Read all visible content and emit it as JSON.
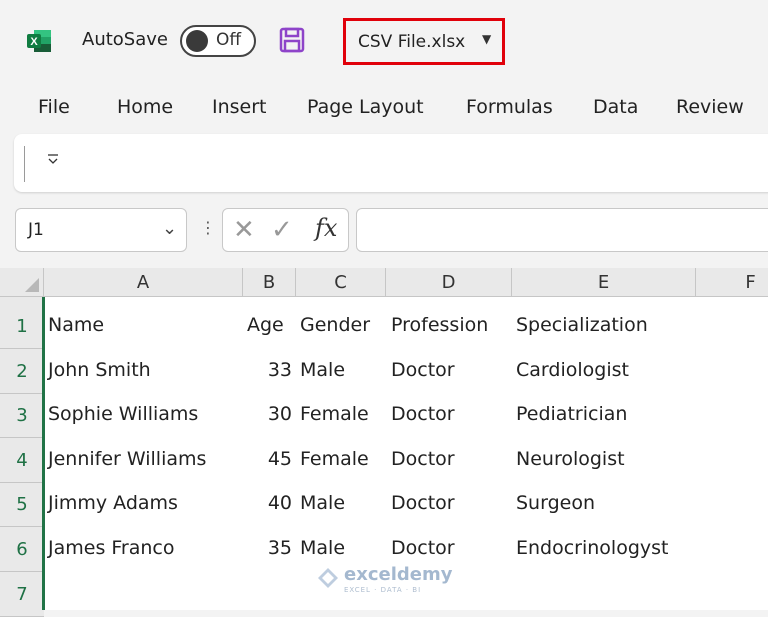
{
  "titlebar": {
    "autosave_label": "AutoSave",
    "autosave_state": "Off",
    "file_name": "CSV File.xlsx",
    "accent": "#e0000a",
    "excel_green": "#217346"
  },
  "menu": [
    "File",
    "Home",
    "Insert",
    "Page Layout",
    "Formulas",
    "Data",
    "Review"
  ],
  "formula_bar": {
    "name_box": "J1",
    "fx_label": "fx",
    "formula": ""
  },
  "sheet": {
    "columns": [
      "A",
      "B",
      "C",
      "D",
      "E",
      "F"
    ],
    "rows": [
      "1",
      "2",
      "3",
      "4",
      "5",
      "6",
      "7"
    ],
    "cells": [
      [
        "Name",
        "Age",
        "Gender",
        "Profession",
        "Specialization"
      ],
      [
        "John Smith",
        "33",
        "Male",
        "Doctor",
        "Cardiologist"
      ],
      [
        "Sophie Williams",
        "30",
        "Female",
        "Doctor",
        "Pediatrician"
      ],
      [
        "Jennifer Williams",
        "45",
        "Female",
        "Doctor",
        "Neurologist"
      ],
      [
        "Jimmy Adams",
        "40",
        "Male",
        "Doctor",
        "Surgeon"
      ],
      [
        "James Franco",
        "35",
        "Male",
        "Doctor",
        "Endocrinologyst"
      ]
    ]
  },
  "watermark": {
    "name": "exceldemy",
    "tagline": "EXCEL · DATA · BI"
  }
}
